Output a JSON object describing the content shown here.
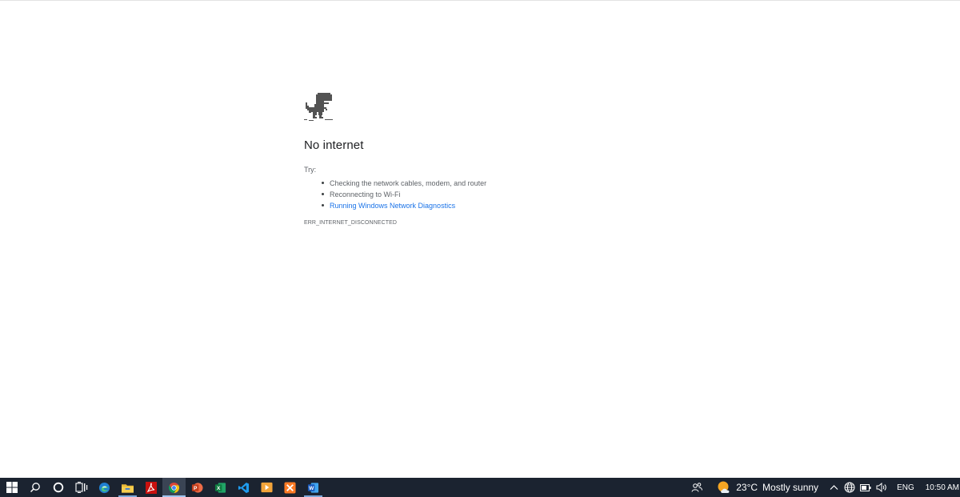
{
  "error_page": {
    "title": "No internet",
    "try_label": "Try:",
    "suggestions": [
      "Checking the network cables, modem, and router",
      "Reconnecting to Wi-Fi",
      "Running Windows Network Diagnostics"
    ],
    "error_code": "ERR_INTERNET_DISCONNECTED",
    "link_color": "#1a73e8",
    "dino_icon": "offline-dino-icon"
  },
  "taskbar": {
    "apps": [
      {
        "name": "start",
        "icon": "windows-logo-icon"
      },
      {
        "name": "search",
        "icon": "search-icon"
      },
      {
        "name": "cortana",
        "icon": "cortana-circle-icon"
      },
      {
        "name": "task-view",
        "icon": "task-view-icon"
      },
      {
        "name": "edge",
        "icon": "edge-icon"
      },
      {
        "name": "file-explorer",
        "icon": "folder-icon"
      },
      {
        "name": "acrobat",
        "icon": "acrobat-icon"
      },
      {
        "name": "chrome",
        "icon": "chrome-icon",
        "active": true
      },
      {
        "name": "powerpoint",
        "icon": "powerpoint-icon"
      },
      {
        "name": "excel",
        "icon": "excel-icon"
      },
      {
        "name": "vscode",
        "icon": "vscode-icon"
      },
      {
        "name": "media-player",
        "icon": "media-player-icon"
      },
      {
        "name": "xampp",
        "icon": "xampp-icon"
      },
      {
        "name": "word",
        "icon": "word-icon"
      }
    ],
    "weather": {
      "temperature": "23°C",
      "condition": "Mostly sunny",
      "icon": "partly-sunny-icon"
    },
    "tray_icons": [
      "people-icon",
      "chevron-up-icon",
      "globe-icon",
      "battery-icon",
      "speaker-icon"
    ],
    "language": "ENG",
    "time": "10:50 AM",
    "background_color": "#1b2330"
  }
}
